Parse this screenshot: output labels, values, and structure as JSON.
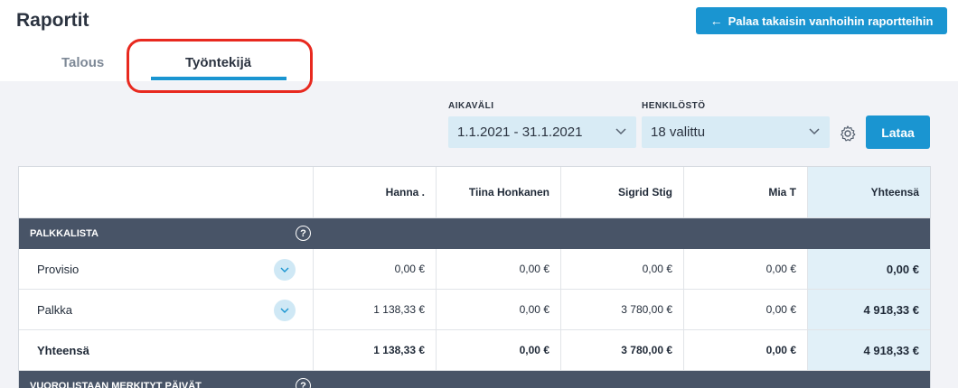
{
  "header": {
    "title": "Raportit",
    "back_button": "Palaa takaisin vanhoihin raportteihin"
  },
  "tabs": [
    {
      "label": "Talous",
      "active": false
    },
    {
      "label": "Työntekijä",
      "active": true
    }
  ],
  "filters": {
    "period_label": "AIKAVÄLI",
    "period_value": "1.1.2021 - 31.1.2021",
    "staff_label": "HENKILÖSTÖ",
    "staff_value": "18 valittu",
    "settings_icon": "gear-icon",
    "load_button": "Lataa"
  },
  "table": {
    "columns": [
      "Hanna .",
      "Tiina Honkanen",
      "Sigrid Stig",
      "Mia T",
      "Yhteensä"
    ],
    "sections": [
      {
        "title": "PALKKALISTA",
        "help": "?",
        "rows": [
          {
            "label": "Provisio",
            "expandable": true,
            "values": [
              "0,00 €",
              "0,00 €",
              "0,00 €",
              "0,00 €",
              "0,00 €"
            ]
          },
          {
            "label": "Palkka",
            "expandable": true,
            "values": [
              "1 138,33 €",
              "0,00 €",
              "3 780,00 €",
              "0,00 €",
              "4 918,33 €"
            ]
          },
          {
            "label": "Yhteensä",
            "expandable": false,
            "values": [
              "1 138,33 €",
              "0,00 €",
              "3 780,00 €",
              "0,00 €",
              "4 918,33 €"
            ]
          }
        ]
      },
      {
        "title": "VUOROLISTAAN MERKITYT PÄIVÄT",
        "help": "?"
      }
    ]
  },
  "colors": {
    "accent": "#1a95d1",
    "section_bg": "#485467",
    "total_col_bg": "#e1f0f8",
    "highlight_ring": "#e8291f"
  }
}
